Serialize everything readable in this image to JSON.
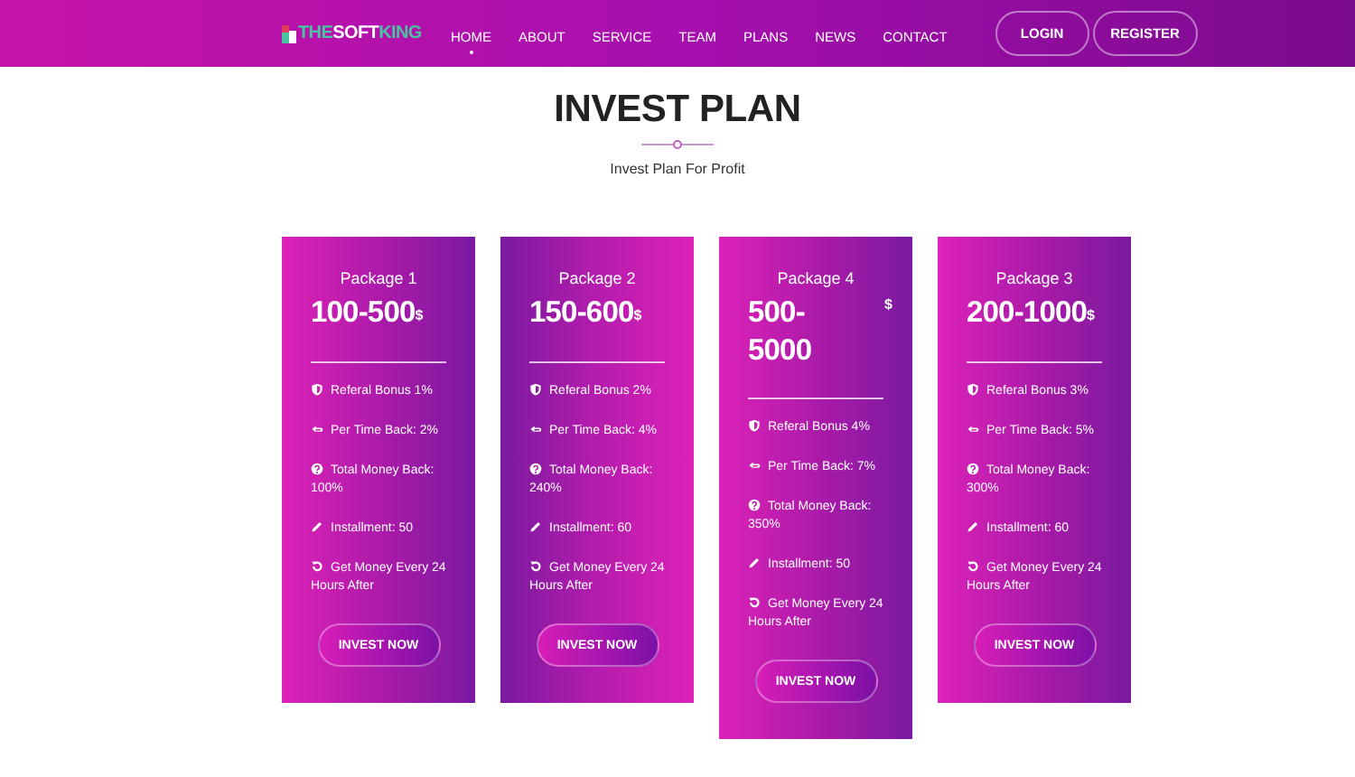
{
  "header": {
    "logo": {
      "part_1": "THE",
      "part_2": "SOFT",
      "part_3": "KING"
    },
    "nav": [
      {
        "label": "HOME",
        "selected": true
      },
      {
        "label": "ABOUT",
        "selected": false
      },
      {
        "label": "SERVICE",
        "selected": false
      },
      {
        "label": "TEAM",
        "selected": false
      },
      {
        "label": "PLANS",
        "selected": false
      },
      {
        "label": "NEWS",
        "selected": false
      },
      {
        "label": "CONTACT",
        "selected": false
      }
    ],
    "buttons": [
      "LOGIN",
      "REGISTER"
    ]
  },
  "section": {
    "title": "INVEST PLAN",
    "subtitle": "Invest Plan For Profit"
  },
  "plans": [
    {
      "name": "Package 1",
      "price": "100-500",
      "currency": "$",
      "reversed": false,
      "features": [
        {
          "kind": "shield",
          "text": "Referal Bonus 1%"
        },
        {
          "kind": "back",
          "text": "Per Time Back: 2%"
        },
        {
          "kind": "question",
          "text": "Total Money Back: 100%"
        },
        {
          "kind": "pencil",
          "text": "Installment: 50"
        },
        {
          "kind": "repeat",
          "text": "Get Money Every 24 Hours After"
        }
      ],
      "button": "INVEST NOW"
    },
    {
      "name": "Package 2",
      "price": "150-600",
      "currency": "$",
      "reversed": true,
      "features": [
        {
          "kind": "shield",
          "text": "Referal Bonus 2%"
        },
        {
          "kind": "back",
          "text": "Per Time Back: 4%"
        },
        {
          "kind": "question",
          "text": "Total Money Back: 240%"
        },
        {
          "kind": "pencil",
          "text": "Installment: 60"
        },
        {
          "kind": "repeat",
          "text": "Get Money Every 24 Hours After"
        }
      ],
      "button": "INVEST NOW"
    },
    {
      "name": "Package 4",
      "price": "500-\n5000",
      "currency": "$",
      "reversed": false,
      "features": [
        {
          "kind": "shield",
          "text": "Referal Bonus 4%"
        },
        {
          "kind": "back",
          "text": "Per Time Back: 7%"
        },
        {
          "kind": "question",
          "text": "Total Money Back: 350%"
        },
        {
          "kind": "pencil",
          "text": "Installment: 50"
        },
        {
          "kind": "repeat",
          "text": "Get Money Every 24 Hours After"
        }
      ],
      "button": "INVEST NOW"
    },
    {
      "name": "Package 3",
      "price": "200-1000",
      "currency": "$",
      "reversed": false,
      "features": [
        {
          "kind": "shield",
          "text": "Referal Bonus 3%"
        },
        {
          "kind": "back",
          "text": "Per Time Back: 5%"
        },
        {
          "kind": "question",
          "text": "Total Money Back: 300%"
        },
        {
          "kind": "pencil",
          "text": "Installment: 60"
        },
        {
          "kind": "repeat",
          "text": "Get Money Every 24 Hours After"
        }
      ],
      "button": "INVEST NOW"
    }
  ]
}
